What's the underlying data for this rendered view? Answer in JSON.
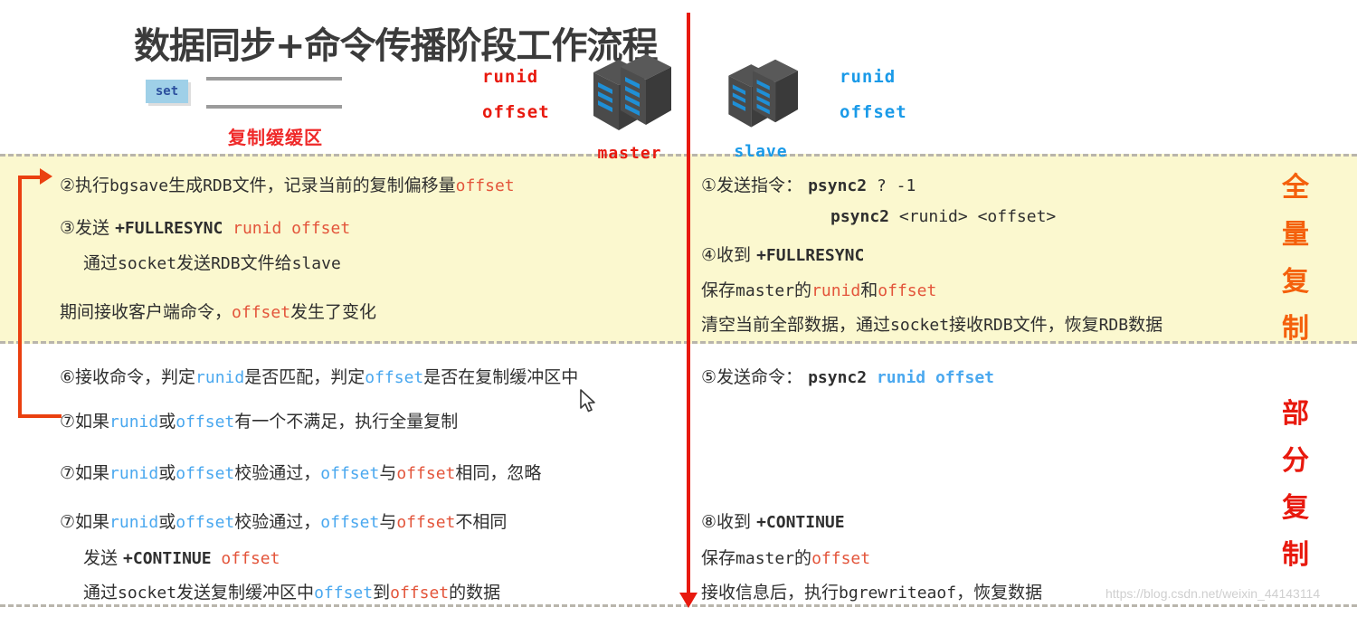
{
  "header": {
    "title": "数据同步+命令传播阶段工作流程",
    "set_label": "set",
    "buffer_label": "复制缓缓区",
    "master": {
      "name": "master",
      "fields": [
        "runid",
        "offset"
      ],
      "icon": "server-rack-icon"
    },
    "slave": {
      "name": "slave",
      "fields": [
        "runid",
        "offset"
      ],
      "icon": "server-rack-icon"
    }
  },
  "phases": [
    {
      "id": "full",
      "label": "全量复制",
      "color": "#f4600c"
    },
    {
      "id": "partial",
      "label": "部分复制",
      "color": "#e8190e"
    }
  ],
  "master_column": {
    "full_replication": [
      {
        "id": "step2",
        "segments": [
          {
            "t": "②执行",
            "c": "dark"
          },
          {
            "t": "bgsave",
            "c": "dark-mono"
          },
          {
            "t": "生成",
            "c": "dark"
          },
          {
            "t": "RDB",
            "c": "dark-mono"
          },
          {
            "t": "文件，记录当前的复制偏移量",
            "c": "dark"
          },
          {
            "t": "offset",
            "c": "red-mono"
          }
        ]
      },
      {
        "id": "step3",
        "segments": [
          {
            "t": "③发送 ",
            "c": "dark"
          },
          {
            "t": "+FULLRESYNC",
            "c": "dark-mono-bold"
          },
          {
            "t": " runid offset",
            "c": "red-mono"
          }
        ]
      },
      {
        "id": "step3b",
        "segments": [
          {
            "t": "通过",
            "c": "dark"
          },
          {
            "t": "socket",
            "c": "dark-mono"
          },
          {
            "t": "发送",
            "c": "dark"
          },
          {
            "t": "RDB",
            "c": "dark-mono"
          },
          {
            "t": "文件给",
            "c": "dark"
          },
          {
            "t": "slave",
            "c": "dark-mono"
          }
        ]
      },
      {
        "id": "note1",
        "segments": [
          {
            "t": "期间接收客户端命令，",
            "c": "dark"
          },
          {
            "t": "offset",
            "c": "red-mono"
          },
          {
            "t": "发生了变化",
            "c": "dark"
          }
        ]
      }
    ],
    "partial_replication": [
      {
        "id": "step6",
        "segments": [
          {
            "t": "⑥接收命令，判定",
            "c": "dark"
          },
          {
            "t": "runid",
            "c": "blue-mono"
          },
          {
            "t": "是否匹配，判定",
            "c": "dark"
          },
          {
            "t": "offset",
            "c": "blue-mono"
          },
          {
            "t": "是否在复制缓冲区中",
            "c": "dark"
          }
        ]
      },
      {
        "id": "step7a",
        "segments": [
          {
            "t": "⑦如果",
            "c": "dark"
          },
          {
            "t": "runid",
            "c": "blue-mono"
          },
          {
            "t": "或",
            "c": "dark"
          },
          {
            "t": "offset",
            "c": "blue-mono"
          },
          {
            "t": "有一个不满足，执行全量复制",
            "c": "dark"
          }
        ]
      },
      {
        "id": "step7b",
        "segments": [
          {
            "t": "⑦如果",
            "c": "dark"
          },
          {
            "t": "runid",
            "c": "blue-mono"
          },
          {
            "t": "或",
            "c": "dark"
          },
          {
            "t": "offset",
            "c": "blue-mono"
          },
          {
            "t": "校验通过，",
            "c": "dark"
          },
          {
            "t": "offset",
            "c": "blue-mono"
          },
          {
            "t": "与",
            "c": "dark"
          },
          {
            "t": "offset",
            "c": "red-mono"
          },
          {
            "t": "相同，忽略",
            "c": "dark"
          }
        ]
      },
      {
        "id": "step7c",
        "segments": [
          {
            "t": "⑦如果",
            "c": "dark"
          },
          {
            "t": "runid",
            "c": "blue-mono"
          },
          {
            "t": "或",
            "c": "dark"
          },
          {
            "t": "offset",
            "c": "blue-mono"
          },
          {
            "t": "校验通过，",
            "c": "dark"
          },
          {
            "t": "offset",
            "c": "blue-mono"
          },
          {
            "t": "与",
            "c": "dark"
          },
          {
            "t": "offset",
            "c": "red-mono"
          },
          {
            "t": "不相同",
            "c": "dark"
          }
        ]
      },
      {
        "id": "step7d",
        "segments": [
          {
            "t": "发送 ",
            "c": "dark"
          },
          {
            "t": "+CONTINUE",
            "c": "dark-mono-bold"
          },
          {
            "t": " offset",
            "c": "red-mono"
          }
        ]
      },
      {
        "id": "step7e",
        "segments": [
          {
            "t": "通过",
            "c": "dark"
          },
          {
            "t": "socket",
            "c": "dark-mono"
          },
          {
            "t": "发送复制缓冲区中",
            "c": "dark"
          },
          {
            "t": "offset",
            "c": "blue-mono"
          },
          {
            "t": "到",
            "c": "dark"
          },
          {
            "t": "offset",
            "c": "red-mono"
          },
          {
            "t": "的数据",
            "c": "dark"
          }
        ]
      }
    ]
  },
  "slave_column": {
    "full_replication": [
      {
        "id": "step1",
        "segments": [
          {
            "t": "①发送指令： ",
            "c": "dark"
          },
          {
            "t": "psync2",
            "c": "dark-mono-bold"
          },
          {
            "t": "  ? -1",
            "c": "dark-mono"
          }
        ]
      },
      {
        "id": "step1b",
        "segments": [
          {
            "t": "psync2",
            "c": "dark-mono-bold"
          },
          {
            "t": "  <runid> <offset>",
            "c": "dark-mono"
          }
        ]
      },
      {
        "id": "step4",
        "segments": [
          {
            "t": "④收到 ",
            "c": "dark"
          },
          {
            "t": "+FULLRESYNC",
            "c": "dark-mono-bold"
          }
        ]
      },
      {
        "id": "step4b",
        "segments": [
          {
            "t": "保存",
            "c": "dark"
          },
          {
            "t": "master",
            "c": "dark-mono"
          },
          {
            "t": "的",
            "c": "dark"
          },
          {
            "t": "runid",
            "c": "red-mono"
          },
          {
            "t": "和",
            "c": "dark"
          },
          {
            "t": "offset",
            "c": "red-mono"
          }
        ]
      },
      {
        "id": "step4c",
        "segments": [
          {
            "t": "清空当前全部数据，通过",
            "c": "dark"
          },
          {
            "t": "socket",
            "c": "dark-mono"
          },
          {
            "t": "接收",
            "c": "dark"
          },
          {
            "t": "RDB",
            "c": "dark-mono"
          },
          {
            "t": "文件，恢复",
            "c": "dark"
          },
          {
            "t": "RDB",
            "c": "dark-mono"
          },
          {
            "t": "数据",
            "c": "dark"
          }
        ]
      }
    ],
    "partial_replication": [
      {
        "id": "step5",
        "segments": [
          {
            "t": "⑤发送命令： ",
            "c": "dark"
          },
          {
            "t": "psync2",
            "c": "dark-mono-bold"
          },
          {
            "t": "  runid offset",
            "c": "blue-mono-bold"
          }
        ]
      },
      {
        "id": "step8",
        "segments": [
          {
            "t": "⑧收到 ",
            "c": "dark"
          },
          {
            "t": "+CONTINUE",
            "c": "dark-mono-bold"
          }
        ]
      },
      {
        "id": "step8b",
        "segments": [
          {
            "t": "保存",
            "c": "dark"
          },
          {
            "t": "master",
            "c": "dark-mono"
          },
          {
            "t": "的",
            "c": "dark"
          },
          {
            "t": "offset",
            "c": "red-mono"
          }
        ]
      },
      {
        "id": "step8c",
        "segments": [
          {
            "t": "接收信息后，执行",
            "c": "dark"
          },
          {
            "t": "bgrewriteaof",
            "c": "dark-mono"
          },
          {
            "t": "，恢复数据",
            "c": "dark"
          }
        ]
      }
    ]
  },
  "watermark": "https://blog.csdn.net/weixin_44143114",
  "colors": {
    "band": "#fbf8cf",
    "dashed": "#b9b5ac",
    "red": "#e8190e",
    "blue": "#1a9ae8",
    "orange": "#f4600c",
    "arrow": "#ea4010"
  }
}
